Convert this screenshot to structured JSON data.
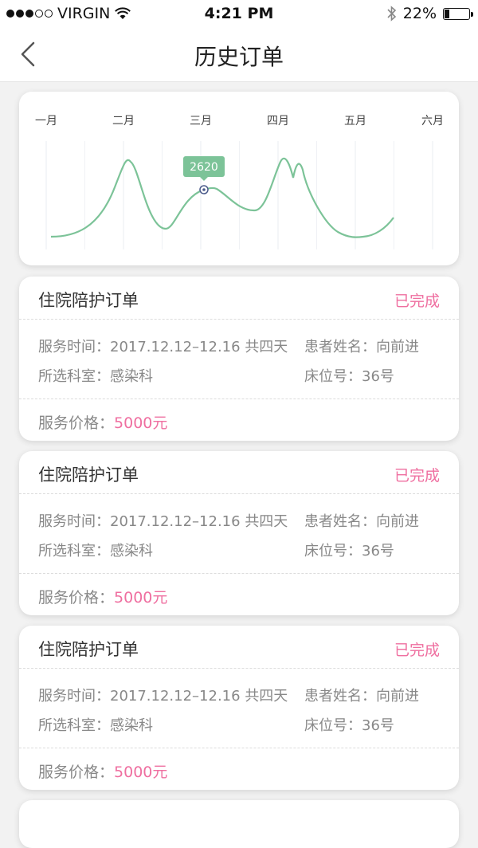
{
  "status_bar": {
    "carrier": "VIRGIN",
    "time": "4:21 PM",
    "battery": "22%",
    "battery_level": 0.22
  },
  "nav": {
    "title": "历史订单",
    "back_icon": "chevron-left-icon"
  },
  "chart_data": {
    "type": "line",
    "categories": [
      "一月",
      "二月",
      "三月",
      "四月",
      "五月",
      "六月"
    ],
    "highlight": {
      "category": "三月",
      "value": 2620,
      "label": "2620"
    },
    "color": "#7cc398",
    "grid": true
  },
  "orders": [
    {
      "title": "住院陪护订单",
      "status": "已完成",
      "service_time_label": "服务时间：",
      "service_time": "2017.12.12–12.16 共四天",
      "patient_label": "患者姓名：",
      "patient": "向前进",
      "dept_label": "所选科室：",
      "dept": "感染科",
      "bed_label": "床位号：",
      "bed": "36号",
      "price_label": "服务价格：",
      "price": "5000元"
    },
    {
      "title": "住院陪护订单",
      "status": "已完成",
      "service_time_label": "服务时间：",
      "service_time": "2017.12.12–12.16 共四天",
      "patient_label": "患者姓名：",
      "patient": "向前进",
      "dept_label": "所选科室：",
      "dept": "感染科",
      "bed_label": "床位号：",
      "bed": "36号",
      "price_label": "服务价格：",
      "price": "5000元"
    },
    {
      "title": "住院陪护订单",
      "status": "已完成",
      "service_time_label": "服务时间：",
      "service_time": "2017.12.12–12.16 共四天",
      "patient_label": "患者姓名：",
      "patient": "向前进",
      "dept_label": "所选科室：",
      "dept": "感染科",
      "bed_label": "床位号：",
      "bed": "36号",
      "price_label": "服务价格：",
      "price": "5000元"
    }
  ],
  "colors": {
    "accent_pink": "#ef6fa0",
    "line_green": "#7cc398"
  }
}
